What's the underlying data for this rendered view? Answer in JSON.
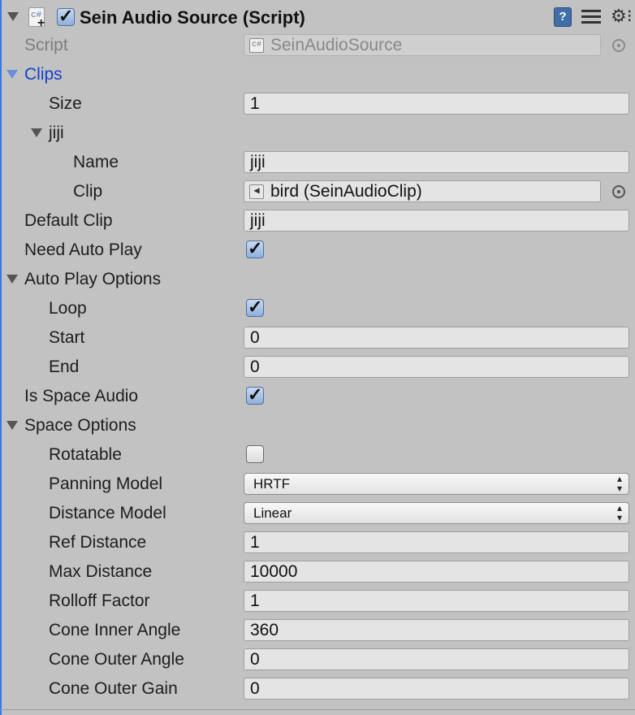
{
  "component": {
    "title": "Sein Audio Source (Script)",
    "enabled": true,
    "icons": [
      "script-icon",
      "help-icon",
      "preset-icon",
      "gear-icon"
    ]
  },
  "script": {
    "label": "Script",
    "value": "SeinAudioSource"
  },
  "clips": {
    "label": "Clips",
    "size_label": "Size",
    "size_value": "1",
    "element": {
      "label": "jiji",
      "name_label": "Name",
      "name_value": "jiji",
      "clip_label": "Clip",
      "clip_value": "bird (SeinAudioClip)"
    }
  },
  "default_clip": {
    "label": "Default Clip",
    "value": "jiji"
  },
  "need_auto_play": {
    "label": "Need Auto Play",
    "checked": true
  },
  "auto_play_options": {
    "label": "Auto Play Options",
    "loop_label": "Loop",
    "loop_checked": true,
    "start_label": "Start",
    "start_value": "0",
    "end_label": "End",
    "end_value": "0"
  },
  "is_space_audio": {
    "label": "Is Space Audio",
    "checked": true
  },
  "space_options": {
    "label": "Space Options",
    "rotatable_label": "Rotatable",
    "rotatable_checked": false,
    "panning_model_label": "Panning Model",
    "panning_model_value": "HRTF",
    "distance_model_label": "Distance Model",
    "distance_model_value": "Linear",
    "ref_distance_label": "Ref Distance",
    "ref_distance_value": "1",
    "max_distance_label": "Max Distance",
    "max_distance_value": "10000",
    "rolloff_factor_label": "Rolloff Factor",
    "rolloff_factor_value": "1",
    "cone_inner_angle_label": "Cone Inner Angle",
    "cone_inner_angle_value": "360",
    "cone_outer_angle_label": "Cone Outer Angle",
    "cone_outer_angle_value": "0",
    "cone_outer_gain_label": "Cone Outer Gain",
    "cone_outer_gain_value": "0"
  },
  "colors": {
    "background": "#c2c2c2",
    "field": "#e4e4e4",
    "accent_blue": "#1240c9",
    "checkbox_checked": "#8fb0dd"
  }
}
